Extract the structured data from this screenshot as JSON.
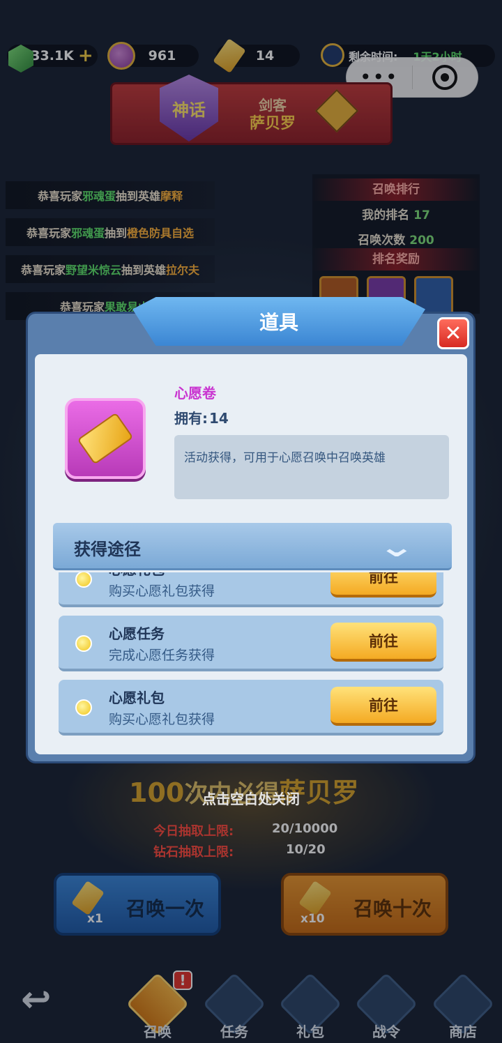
{
  "resources": {
    "gems": "33.1K",
    "gems_plus": "+",
    "coins": "961",
    "tickets": "14",
    "remaining_label": "剩余时间:",
    "remaining_value": "1天2小时"
  },
  "capsule": {
    "more": "•••"
  },
  "banner": {
    "rarity": "神话",
    "role": "剑客",
    "hero": "萨贝罗"
  },
  "feed": [
    {
      "prefix": "恭喜玩家",
      "player": "邪魂蛋",
      "verb": "抽到英雄",
      "item": "摩释"
    },
    {
      "prefix": "恭喜玩家",
      "player": "邪魂蛋",
      "verb": "抽到",
      "item": "橙色防具自选"
    },
    {
      "prefix": "恭喜玩家",
      "player": "野望米惊云",
      "verb": "抽到英雄",
      "item": "拉尔夫"
    },
    {
      "prefix": "恭喜玩家",
      "player": "果敢易山山",
      "verb": "",
      "item": ""
    }
  ],
  "ranking": {
    "title": "召唤排行",
    "my_rank_label": "我的排名",
    "my_rank": "17",
    "summon_count_label": "召唤次数",
    "summon_count": "200",
    "reward_title": "排名奖励"
  },
  "dialog": {
    "title": "道具",
    "close": "✕",
    "item_name": "心愿卷",
    "owned_label": "拥有:",
    "owned_count": "14",
    "description": "活动获得，可用于心愿召唤中召唤英雄",
    "routes_title": "获得途径",
    "routes": [
      {
        "title": "心愿礼包",
        "subtitle": "购买心愿礼包获得",
        "button": "前往"
      },
      {
        "title": "心愿任务",
        "subtitle": "完成心愿任务获得",
        "button": "前往"
      },
      {
        "title": "心愿礼包",
        "subtitle": "购买心愿礼包获得",
        "button": "前往"
      }
    ]
  },
  "guarantee": {
    "prefix": "100",
    "middle": "次内必得",
    "hero": "萨贝罗"
  },
  "close_hint": "点击空白处关闭",
  "limits": [
    {
      "label": "今日抽取上限:",
      "value": "20/10000"
    },
    {
      "label": "钻石抽取上限:",
      "value": "10/20"
    }
  ],
  "summon": {
    "once_label": "召唤一次",
    "once_count": "x1",
    "ten_label": "召唤十次",
    "ten_count": "x10"
  },
  "nav": {
    "back": "↩",
    "items": [
      {
        "label": "召唤",
        "badge": "!"
      },
      {
        "label": "任务"
      },
      {
        "label": "礼包"
      },
      {
        "label": "战令"
      },
      {
        "label": "商店"
      }
    ]
  }
}
